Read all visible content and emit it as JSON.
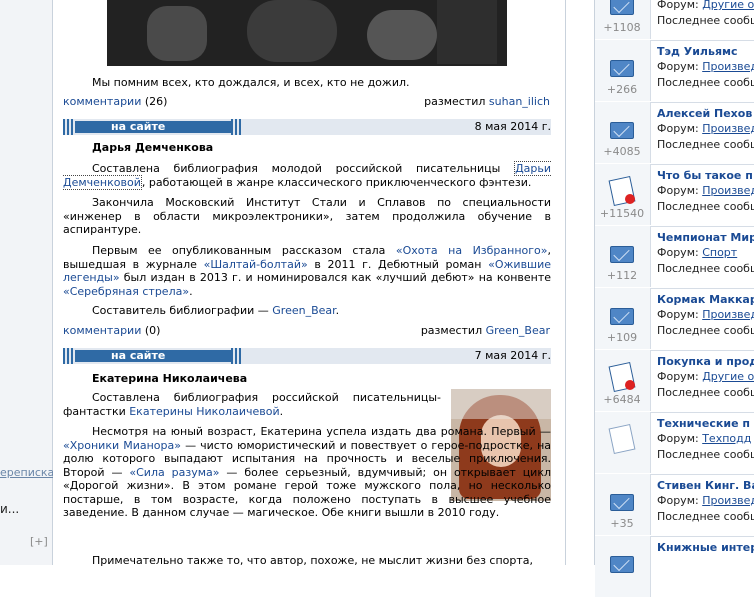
{
  "left": {
    "link1": "ереписка",
    "text2": "и...",
    "expand": "[+]"
  },
  "top_post": {
    "caption": "Мы помним всех, кто дождался, и всех, кто не дожил.",
    "comments_label": "комментарии",
    "comments_count": "(26)",
    "posted_by": "разместил",
    "author": "suhan_ilich"
  },
  "post1": {
    "section": "на сайте",
    "date": "8 мая 2014 г.",
    "title": "Дарья Демченкова",
    "p1_a": "Составлена библиография молодой российской писательницы",
    "p1_link": "Дарьи Демченковой",
    "p1_b": ", работающей в жанре классического приключенческого фэнтези.",
    "p2": "Закончила Московский Институт Стали и Сплавов по специальности «инженер в области микроэлектроники», затем продолжила обучение в аспирантуре.",
    "p3_a": "Первым ее опубликованным рассказом стала",
    "p3_l1": "«Охота на Избранного»",
    "p3_b": ", вышедшая в журнале",
    "p3_l2": "«Шалтай-болтай»",
    "p3_c": "в 2011 г. Дебютный роман",
    "p3_l3": "«Ожившие легенды»",
    "p3_d": "был издан в 2013 г. и номинировался как «лучший дебют» на конвенте",
    "p3_l4": "«Серебряная стрела»",
    "p3_e": ".",
    "p4_a": "Составитель библиографии —",
    "p4_link": "Green_Bear",
    "p4_b": ".",
    "comments_label": "комментарии",
    "comments_count": "(0)",
    "posted_by": "разместил",
    "author": "Green_Bear"
  },
  "post2": {
    "section": "на сайте",
    "date": "7 мая 2014 г.",
    "title": "Екатерина Николаичева",
    "p1_a": "Составлена библиография российской писательницы-фантастки",
    "p1_link": "Екатерины Николаичевой",
    "p1_b": ".",
    "p2_a": "Несмотря на юный возраст, Екатерина успела издать два романа. Первый —",
    "p2_l1": "«Хроники Мианора»",
    "p2_b": "— чисто юмористический и повествует о герое-подростке, на долю которого выпадают испытания на прочность и веселые приключения. Второй —",
    "p2_l2": "«Сила разума»",
    "p2_c": "— более серьезный, вдумчивый; он открывает цикл «Дорогой жизни». В этом романе герой тоже мужского пола, но несколько постарше, в том возрасте, когда положено поступать в высшее учебное заведение. В данном случае — магическое. Обе книги вышли в 2010 году.",
    "p3": "Примечательно также то, что автор, похоже, не мыслит жизни без спорта,"
  },
  "right": {
    "forum_label": "Форум:",
    "last_label": "Последнее сообщ",
    "items": [
      {
        "count": "+1108",
        "title": "",
        "forum": "Другие о",
        "icon": "envelope-icon"
      },
      {
        "count": "+266",
        "title": "Тэд Уильямс",
        "forum": "Произвед",
        "icon": "envelope-icon"
      },
      {
        "count": "+4085",
        "title": "Алексей Пехов",
        "forum": "Произвед",
        "icon": "envelope-icon"
      },
      {
        "count": "+11540",
        "title": "Что бы такое п",
        "forum": "Произвед",
        "icon": "pinned-note-icon"
      },
      {
        "count": "+112",
        "title": "Чемпионат Мир",
        "forum": "Спорт",
        "icon": "envelope-icon"
      },
      {
        "count": "+109",
        "title": "Кормак Маккар",
        "forum": "Произвед",
        "icon": "envelope-icon"
      },
      {
        "count": "+6484",
        "title": "Покупка и прод",
        "forum": "Другие о",
        "icon": "pinned-note-icon"
      },
      {
        "count": "",
        "title": "Технические п",
        "forum": "Техподд",
        "icon": "note-icon"
      },
      {
        "count": "+35",
        "title": "Стивен Кинг. Ва",
        "forum": "Произвед",
        "icon": "envelope-icon"
      },
      {
        "count": "",
        "title": "Книжные интер",
        "forum": "",
        "icon": "envelope-icon"
      }
    ]
  }
}
